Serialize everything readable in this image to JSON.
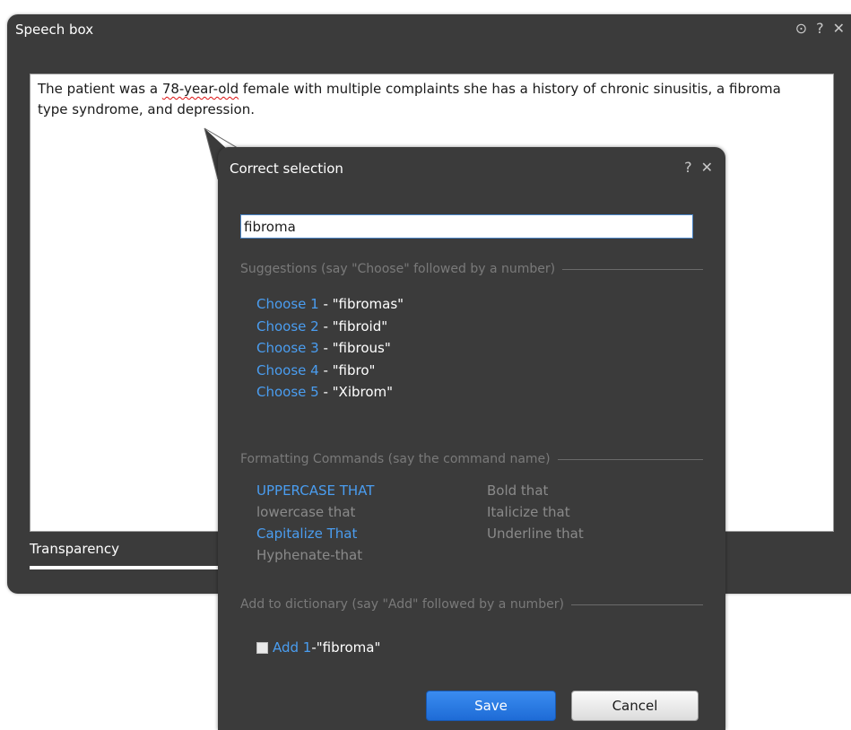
{
  "speech_box": {
    "title": "Speech box",
    "text_before": "The patient was a ",
    "text_underlined": "78-year-old",
    "text_after": " female with multiple complaints she has a history of chronic sinusitis, a fibroma type syndrome, and depression.",
    "transparency_label": "Transparency",
    "transparency_value": 0.23,
    "title_icons": {
      "target": "⊙",
      "help": "?",
      "close": "✕"
    }
  },
  "correct_selection": {
    "title": "Correct selection",
    "title_icons": {
      "help": "?",
      "close": "✕"
    },
    "selected_text": "fibroma",
    "suggestions_header": "Suggestions (say \"Choose\" followed by a number)",
    "suggestions": [
      {
        "command": "Choose 1",
        "sep": " - ",
        "value": "\"fibromas\""
      },
      {
        "command": "Choose 2",
        "sep": " - ",
        "value": "\"fibroid\""
      },
      {
        "command": "Choose 3",
        "sep": " - ",
        "value": "\"fibrous\""
      },
      {
        "command": "Choose 4",
        "sep": " - ",
        "value": "\"fibro\""
      },
      {
        "command": "Choose 5",
        "sep": " - ",
        "value": "\"Xibrom\""
      }
    ],
    "formatting_header": "Formatting Commands (say the command name)",
    "formatting": {
      "uppercase": "UPPERCASE THAT",
      "lowercase": "lowercase that",
      "capitalize": "Capitalize That",
      "hyphenate": "Hyphenate-that",
      "bold": "Bold that",
      "italicize": "Italicize that",
      "underline": "Underline that"
    },
    "dictionary_header": "Add to dictionary (say \"Add\" followed by a number)",
    "dictionary_item": {
      "command": "Add 1",
      "sep": " - ",
      "value": "\"fibroma\""
    },
    "save_label": "Save",
    "cancel_label": "Cancel"
  },
  "colors": {
    "window_bg": "#3b3b3b",
    "link": "#4a9df0",
    "dim_text": "#8a8a8a",
    "save_button": "#1e6bd6"
  }
}
